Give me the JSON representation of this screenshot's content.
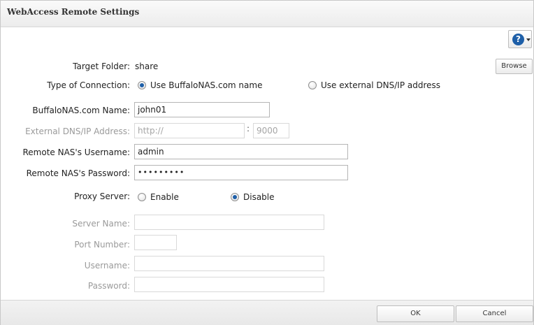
{
  "window": {
    "title": "WebAccess Remote Settings"
  },
  "help": {
    "icon": "help-icon",
    "glyph": "?"
  },
  "target_folder": {
    "label": "Target Folder:",
    "value": "share",
    "browse_label": "Browse"
  },
  "connection": {
    "label": "Type of Connection:",
    "options": [
      {
        "label": "Use BuffaloNAS.com name",
        "checked": true
      },
      {
        "label": "Use external DNS/IP address",
        "checked": false
      }
    ]
  },
  "buffalonas_name": {
    "label": "BuffaloNAS.com Name:",
    "value": "john01"
  },
  "external_dns": {
    "label": "External DNS/IP Address:",
    "value": "http://",
    "port": "9000",
    "separator": ":"
  },
  "remote_username": {
    "label": "Remote NAS's Username:",
    "value": "admin"
  },
  "remote_password": {
    "label": "Remote NAS's Password:",
    "value": "•••••••••"
  },
  "proxy": {
    "label": "Proxy Server:",
    "options": [
      {
        "label": "Enable",
        "checked": false
      },
      {
        "label": "Disable",
        "checked": true
      }
    ],
    "server_name": {
      "label": "Server Name:",
      "value": ""
    },
    "port_number": {
      "label": "Port Number:",
      "value": ""
    },
    "username": {
      "label": "Username:",
      "value": ""
    },
    "password": {
      "label": "Password:",
      "value": ""
    }
  },
  "footer": {
    "ok_label": "OK",
    "cancel_label": "Cancel"
  }
}
